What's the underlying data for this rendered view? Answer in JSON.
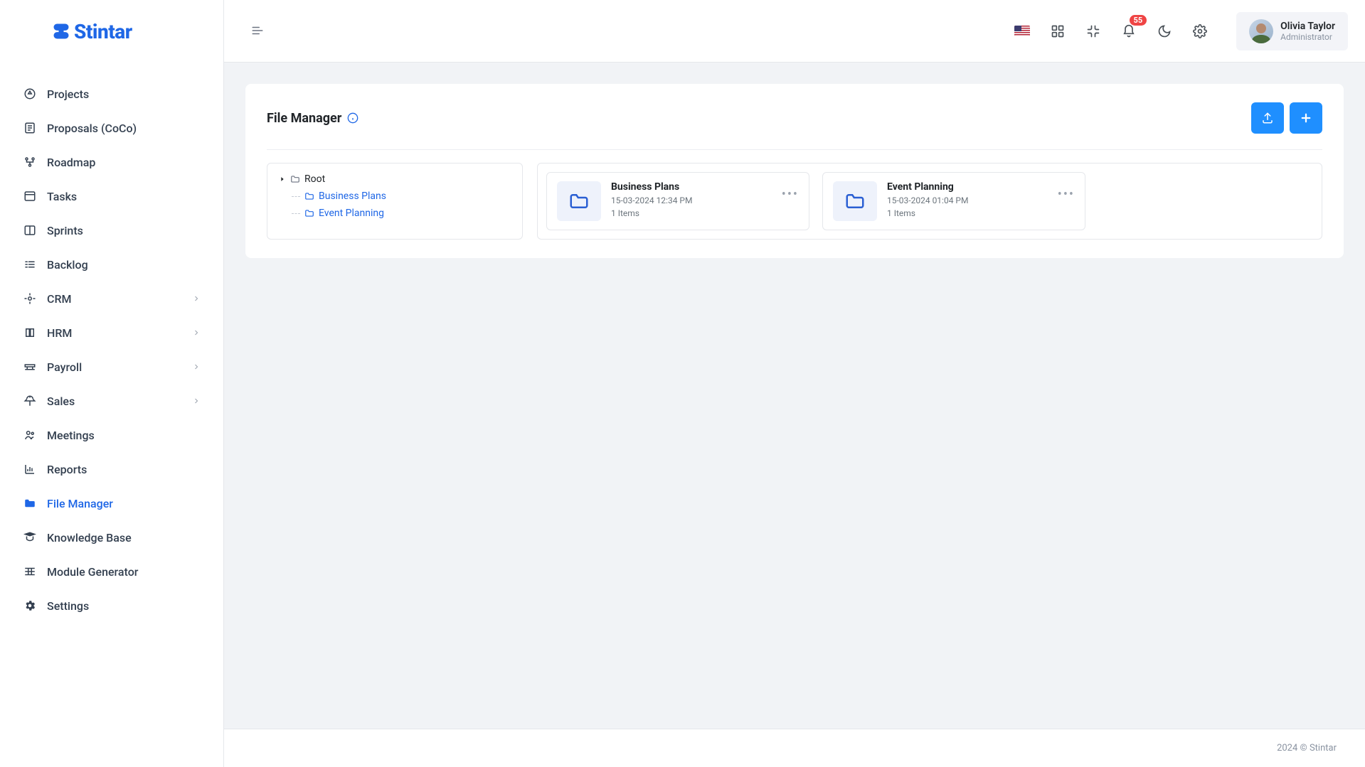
{
  "brand": "Stintar",
  "header": {
    "notification_count": "55",
    "user": {
      "name": "Olivia Taylor",
      "role": "Administrator"
    }
  },
  "sidebar": {
    "items": [
      {
        "label": "Projects",
        "icon": "projects",
        "chev": false
      },
      {
        "label": "Proposals (CoCo)",
        "icon": "proposals",
        "chev": false
      },
      {
        "label": "Roadmap",
        "icon": "roadmap",
        "chev": false
      },
      {
        "label": "Tasks",
        "icon": "tasks",
        "chev": false
      },
      {
        "label": "Sprints",
        "icon": "sprints",
        "chev": false
      },
      {
        "label": "Backlog",
        "icon": "backlog",
        "chev": false
      },
      {
        "label": "CRM",
        "icon": "crm",
        "chev": true
      },
      {
        "label": "HRM",
        "icon": "hrm",
        "chev": true
      },
      {
        "label": "Payroll",
        "icon": "payroll",
        "chev": true
      },
      {
        "label": "Sales",
        "icon": "sales",
        "chev": true
      },
      {
        "label": "Meetings",
        "icon": "meetings",
        "chev": false
      },
      {
        "label": "Reports",
        "icon": "reports",
        "chev": false
      },
      {
        "label": "File Manager",
        "icon": "filemanager",
        "chev": false,
        "active": true
      },
      {
        "label": "Knowledge Base",
        "icon": "kb",
        "chev": false
      },
      {
        "label": "Module Generator",
        "icon": "module",
        "chev": false
      },
      {
        "label": "Settings",
        "icon": "settings",
        "chev": false
      }
    ]
  },
  "page": {
    "title": "File Manager",
    "tree": {
      "root_label": "Root",
      "children": [
        {
          "label": "Business Plans"
        },
        {
          "label": "Event Planning"
        }
      ]
    },
    "folders": [
      {
        "name": "Business Plans",
        "date": "15-03-2024 12:34 PM",
        "items": "1 Items"
      },
      {
        "name": "Event Planning",
        "date": "15-03-2024 01:04 PM",
        "items": "1 Items"
      }
    ]
  },
  "footer": "2024 © Stintar"
}
